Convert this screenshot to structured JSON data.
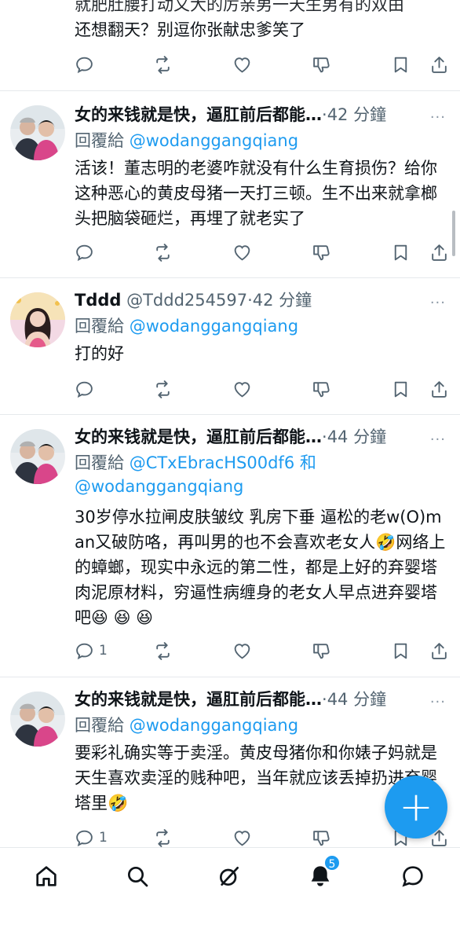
{
  "top_tweet": {
    "text_line_partial": "就肥肚腰打动又大的厉亲男一天生男有的双由",
    "text_line": "还想翻天？别逗你张献忠爹笑了"
  },
  "tweets": [
    {
      "name": "女的来钱就是快，逼肛前后都能…",
      "dot": "·",
      "time": "42 分鐘",
      "reply_label": "回覆給",
      "reply_to": "@wodanggangqiang",
      "reply_to2": "",
      "text": "活该！董志明的老婆咋就没有什么生育损伤？给你这种恶心的黄皮母猪一天打三顿。生不出来就拿榔头把脑袋砸烂，再埋了就老实了",
      "reply_count": "",
      "avatar": "couple-avatar"
    },
    {
      "name": "Tddd",
      "handle": "@Tddd254597",
      "dot": "·",
      "time": "42 分鐘",
      "reply_label": "回覆給",
      "reply_to": "@wodanggangqiang",
      "text": "打的好",
      "reply_count": "",
      "avatar": "woman-avatar"
    },
    {
      "name": "女的来钱就是快，逼肛前后都能…",
      "dot": "·",
      "time": "44 分鐘",
      "reply_label": "回覆給",
      "reply_to": "@CTxEbracHS00df6",
      "reply_and": "和",
      "reply_to2": "@wodanggangqiang",
      "text": "30岁停水拉闸皮肤皱纹 乳房下垂 逼松的老w(O)man又破防咯，再叫男的也不会喜欢老女人🤣网络上的蟑螂，现实中永远的第二性，都是上好的弃婴塔肉泥原材料，穷逼性病缠身的老女人早点进弃婴塔吧😆 😆 😆",
      "reply_count": "1",
      "avatar": "couple-avatar"
    },
    {
      "name": "女的来钱就是快，逼肛前后都能…",
      "dot": "·",
      "time": "44 分鐘",
      "reply_label": "回覆給",
      "reply_to": "@wodanggangqiang",
      "text": "要彩礼确实等于卖淫。黄皮母猪你和你婊子妈就是天生喜欢卖淫的贱种吧，当年就应该丢掉扔进弃婴塔里🤣",
      "reply_count": "1",
      "avatar": "couple-avatar"
    }
  ],
  "more_glyph": "···",
  "fab_label": "+",
  "nav": {
    "notifications_badge": "5",
    "items": [
      "home-icon",
      "search-icon",
      "grok-icon",
      "notifications-icon",
      "messages-icon"
    ]
  },
  "colors": {
    "accent": "#1d9bf0",
    "text": "#0f1419",
    "muted": "#536471",
    "divider": "#e6e9ec"
  }
}
